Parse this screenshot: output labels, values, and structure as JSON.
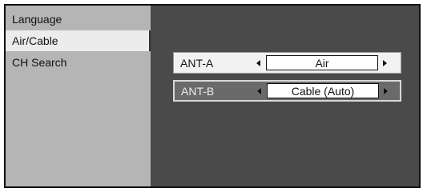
{
  "menu": {
    "items": [
      {
        "label": "Language"
      },
      {
        "label": "Air/Cable"
      },
      {
        "label": "CH Search"
      }
    ],
    "selected": "Air/Cable"
  },
  "settings": {
    "rows": [
      {
        "label": "ANT-A",
        "value": "Air"
      },
      {
        "label": "ANT-B",
        "value": "Cable (Auto)"
      }
    ],
    "focused": "ANT-B"
  },
  "icons": [
    "arrow-left-icon",
    "arrow-right-icon"
  ],
  "colors": {
    "sidebar_bg": "#b5b5b5",
    "selected_item_bg": "#ececec",
    "main_bg": "#4a4a4a",
    "focused_row_bg": "#6a6a6a"
  }
}
